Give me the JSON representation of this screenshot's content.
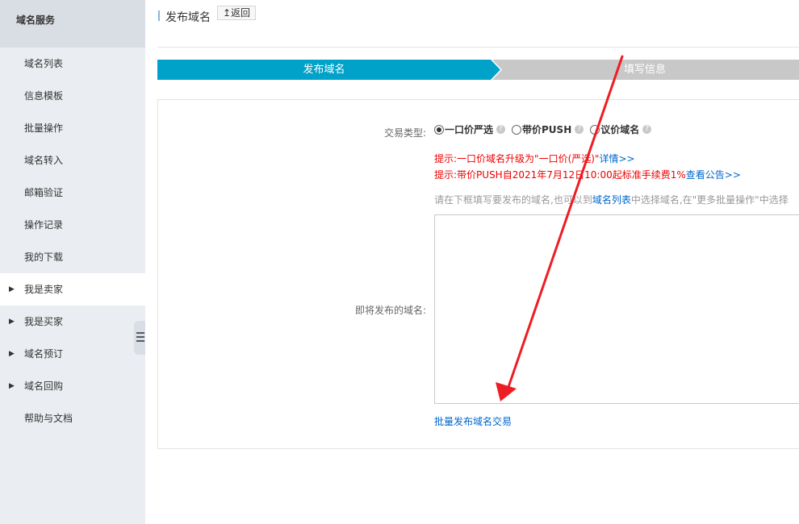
{
  "sidebar": {
    "header": "域名服务",
    "items": [
      {
        "label": "域名列表"
      },
      {
        "label": "信息模板"
      },
      {
        "label": "批量操作"
      },
      {
        "label": "域名转入"
      },
      {
        "label": "邮箱验证"
      },
      {
        "label": "操作记录"
      },
      {
        "label": "我的下载"
      },
      {
        "label": "我是卖家",
        "expandable": true,
        "active": true
      },
      {
        "label": "我是买家",
        "expandable": true
      },
      {
        "label": "域名预订",
        "expandable": true
      },
      {
        "label": "域名回购",
        "expandable": true
      },
      {
        "label": "帮助与文档"
      }
    ]
  },
  "header": {
    "title": "发布域名",
    "back_label": "↥返回"
  },
  "steps": [
    {
      "label": "发布域名",
      "active": true
    },
    {
      "label": "填写信息",
      "active": false
    }
  ],
  "form": {
    "trade_type_label": "交易类型:",
    "options": [
      {
        "label": "一口价严选",
        "checked": true
      },
      {
        "label": "带价PUSH",
        "checked": false
      },
      {
        "label": "议价域名",
        "checked": false
      }
    ],
    "tip1_text": "提示:一口价域名升级为\"一口价(严选)\"",
    "tip1_link": "详情>>",
    "tip2_text": "提示:带价PUSH自2021年7月12日10:00起标准手续费1%",
    "tip2_link": "查看公告>>",
    "hint_prefix": "请在下框填写要发布的域名,也可以到",
    "hint_link": "域名列表",
    "hint_suffix": "中选择域名,在\"更多批量操作\"中选择",
    "domains_label": "即将发布的域名:",
    "domains_value": "",
    "batch_link": "批量发布域名交易"
  },
  "colors": {
    "accent": "#00a2ca",
    "step_inactive": "#c8c8c8",
    "tip_red": "#e00000",
    "link_blue": "#0066cc",
    "annotation_arrow": "#ee1d23"
  }
}
